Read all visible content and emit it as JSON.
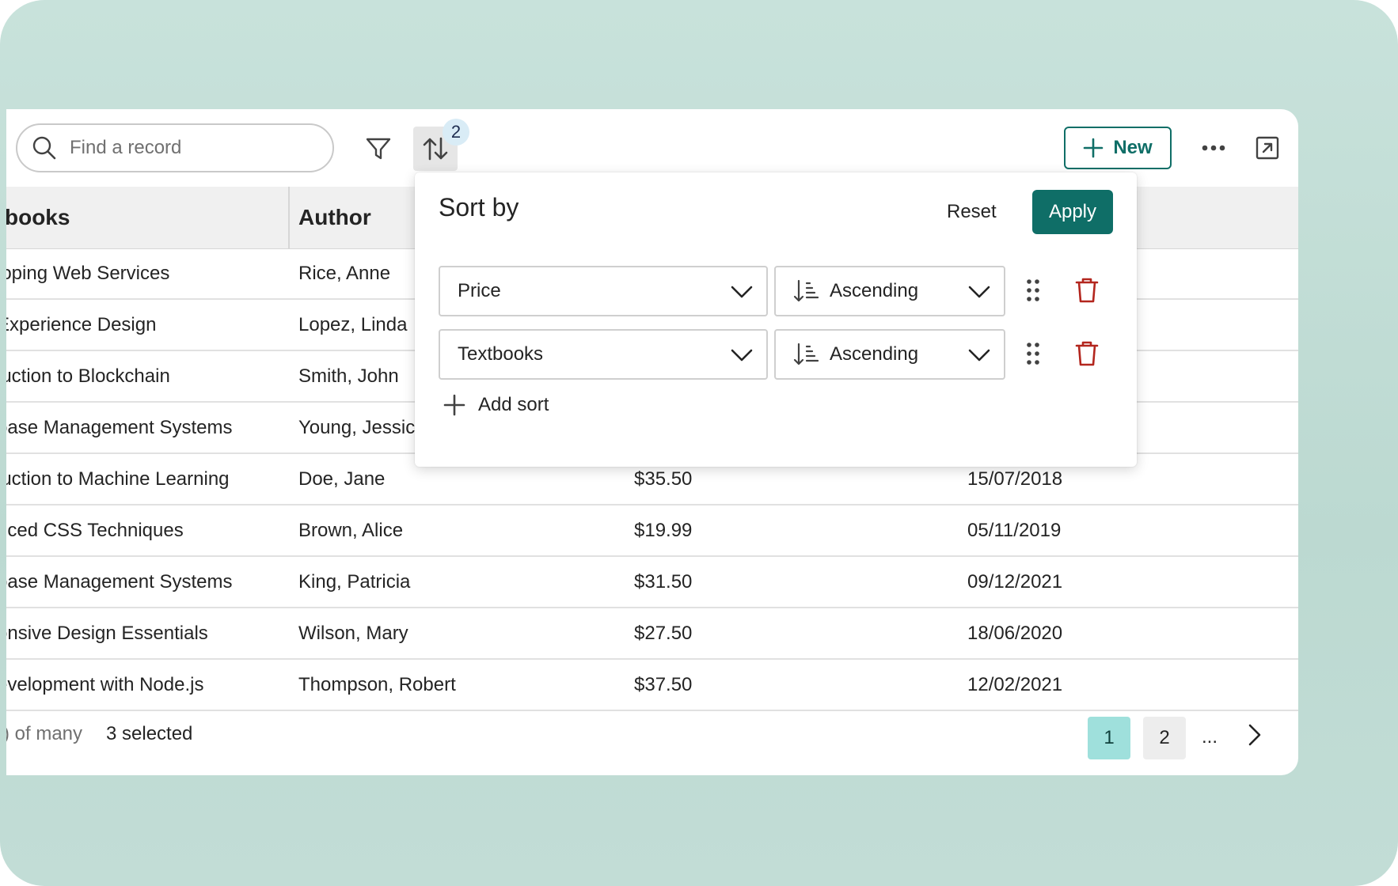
{
  "toolbar": {
    "search_placeholder": "Find a record",
    "sort_count": "2",
    "new_label": "New"
  },
  "table": {
    "headers": [
      "books",
      "Author"
    ],
    "rows": [
      {
        "title": "loping Web Services",
        "author": "Rice, Anne",
        "price": "",
        "date": ""
      },
      {
        "title": "Experience Design",
        "author": "Lopez, Linda",
        "price": "",
        "date": ""
      },
      {
        "title": "luction to Blockchain",
        "author": "Smith, John",
        "price": "",
        "date": ""
      },
      {
        "title": "base Management Systems",
        "author": "Young, Jessic",
        "price": "",
        "date": ""
      },
      {
        "title": "luction to Machine Learning",
        "author": "Doe, Jane",
        "price": "$35.50",
        "date": "15/07/2018"
      },
      {
        "title": "nced CSS Techniques",
        "author": "Brown, Alice",
        "price": "$19.99",
        "date": "05/11/2019"
      },
      {
        "title": "base Management Systems",
        "author": "King, Patricia",
        "price": "$31.50",
        "date": "09/12/2021"
      },
      {
        "title": "onsive Design Essentials",
        "author": "Wilson, Mary",
        "price": "$27.50",
        "date": "18/06/2020"
      },
      {
        "title": "evelopment with Node.js",
        "author": "Thompson, Robert",
        "price": "$37.50",
        "date": "12/02/2021"
      }
    ]
  },
  "footer": {
    "count_text": ") of many",
    "selected_text": "3 selected",
    "pages": [
      "1",
      "2"
    ],
    "ellipsis": "..."
  },
  "sort_popover": {
    "title": "Sort by",
    "reset_label": "Reset",
    "apply_label": "Apply",
    "rules": [
      {
        "field": "Price",
        "direction": "Ascending"
      },
      {
        "field": "Textbooks",
        "direction": "Ascending"
      }
    ],
    "add_label": "Add sort"
  },
  "colors": {
    "accent": "#0f6e67",
    "delete": "#b3261e",
    "active_page": "#9fe0dc",
    "backdrop": "#c2ddd6"
  }
}
